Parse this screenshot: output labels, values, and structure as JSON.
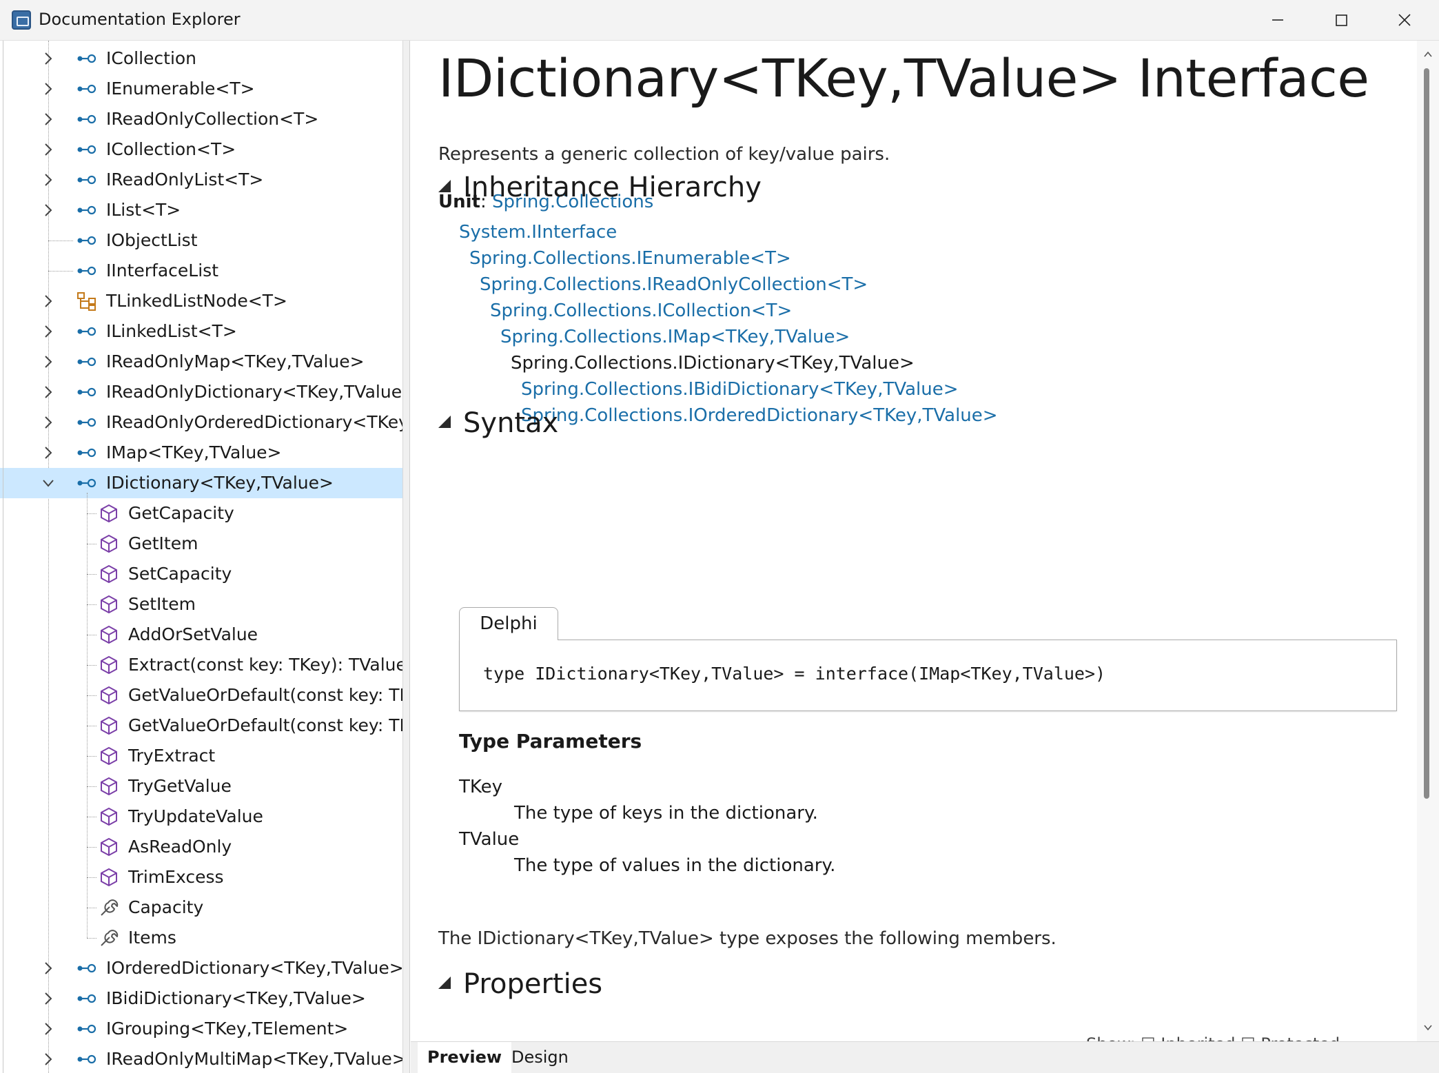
{
  "window": {
    "title": "Documentation Explorer"
  },
  "tree": {
    "items": [
      {
        "label": "ICollection",
        "icon": "interface",
        "expandable": true,
        "level": 0
      },
      {
        "label": "IEnumerable<T>",
        "icon": "interface",
        "expandable": true,
        "level": 0
      },
      {
        "label": "IReadOnlyCollection<T>",
        "icon": "interface",
        "expandable": true,
        "level": 0
      },
      {
        "label": "ICollection<T>",
        "icon": "interface",
        "expandable": true,
        "level": 0
      },
      {
        "label": "IReadOnlyList<T>",
        "icon": "interface",
        "expandable": true,
        "level": 0
      },
      {
        "label": "IList<T>",
        "icon": "interface",
        "expandable": true,
        "level": 0
      },
      {
        "label": "IObjectList",
        "icon": "interface",
        "expandable": false,
        "level": 0
      },
      {
        "label": "IInterfaceList",
        "icon": "interface",
        "expandable": false,
        "level": 0
      },
      {
        "label": "TLinkedListNode<T>",
        "icon": "class",
        "expandable": true,
        "level": 0
      },
      {
        "label": "ILinkedList<T>",
        "icon": "interface",
        "expandable": true,
        "level": 0
      },
      {
        "label": "IReadOnlyMap<TKey,TValue>",
        "icon": "interface",
        "expandable": true,
        "level": 0
      },
      {
        "label": "IReadOnlyDictionary<TKey,TValue>",
        "icon": "interface",
        "expandable": true,
        "level": 0
      },
      {
        "label": "IReadOnlyOrderedDictionary<TKey,TValue>",
        "icon": "interface",
        "expandable": true,
        "level": 0
      },
      {
        "label": "IMap<TKey,TValue>",
        "icon": "interface",
        "expandable": true,
        "level": 0
      },
      {
        "label": "IDictionary<TKey,TValue>",
        "icon": "interface",
        "expandable": true,
        "expanded": true,
        "selected": true,
        "level": 0
      },
      {
        "label": "GetCapacity",
        "icon": "method",
        "level": 1
      },
      {
        "label": "GetItem",
        "icon": "method",
        "level": 1
      },
      {
        "label": "SetCapacity",
        "icon": "method",
        "level": 1
      },
      {
        "label": "SetItem",
        "icon": "method",
        "level": 1
      },
      {
        "label": "AddOrSetValue",
        "icon": "method",
        "level": 1
      },
      {
        "label": "Extract(const key: TKey): TValue",
        "icon": "method",
        "level": 1
      },
      {
        "label": "GetValueOrDefault(const key: TKey",
        "icon": "method",
        "level": 1
      },
      {
        "label": "GetValueOrDefault(const key: TKey",
        "icon": "method",
        "level": 1
      },
      {
        "label": "TryExtract",
        "icon": "method",
        "level": 1
      },
      {
        "label": "TryGetValue",
        "icon": "method",
        "level": 1
      },
      {
        "label": "TryUpdateValue",
        "icon": "method",
        "level": 1
      },
      {
        "label": "AsReadOnly",
        "icon": "method",
        "level": 1
      },
      {
        "label": "TrimExcess",
        "icon": "method",
        "level": 1
      },
      {
        "label": "Capacity",
        "icon": "property",
        "level": 1
      },
      {
        "label": "Items",
        "icon": "property",
        "level": 1
      },
      {
        "label": "IOrderedDictionary<TKey,TValue>",
        "icon": "interface",
        "expandable": true,
        "level": 0
      },
      {
        "label": "IBidiDictionary<TKey,TValue>",
        "icon": "interface",
        "expandable": true,
        "level": 0
      },
      {
        "label": "IGrouping<TKey,TElement>",
        "icon": "interface",
        "expandable": true,
        "level": 0
      },
      {
        "label": "IReadOnlyMultiMap<TKey,TValue>",
        "icon": "interface",
        "expandable": true,
        "level": 0
      }
    ]
  },
  "doc": {
    "title": "IDictionary<TKey,TValue> Interface",
    "summary": "Represents a generic collection of key/value pairs.",
    "unit_label": "Unit",
    "unit_sep": ": ",
    "unit_value": "Spring.Collections",
    "inheritance_heading": "Inheritance Hierarchy",
    "hierarchy": [
      {
        "text": "System.IInterface",
        "link": true
      },
      {
        "text": "Spring.Collections.IEnumerable<T>",
        "link": true
      },
      {
        "text": "Spring.Collections.IReadOnlyCollection<T>",
        "link": true
      },
      {
        "text": "Spring.Collections.ICollection<T>",
        "link": true
      },
      {
        "text": "Spring.Collections.IMap<TKey,TValue>",
        "link": true
      },
      {
        "text": "Spring.Collections.IDictionary<TKey,TValue>",
        "link": false
      },
      {
        "text": "Spring.Collections.IBidiDictionary<TKey,TValue>",
        "link": true
      },
      {
        "text": "Spring.Collections.IOrderedDictionary<TKey,TValue>",
        "link": true
      }
    ],
    "syntax_heading": "Syntax",
    "code_tab": "Delphi",
    "code": "type IDictionary<TKey,TValue> = interface(IMap<TKey,TValue>)",
    "type_params_heading": "Type Parameters",
    "type_params": [
      {
        "name": "TKey",
        "desc": "The type of keys in the dictionary."
      },
      {
        "name": "TValue",
        "desc": "The type of values in the dictionary."
      }
    ],
    "members_text": "The IDictionary<TKey,TValue> type exposes the following members.",
    "properties_heading": "Properties",
    "show_strip": "Show:  ☐ Inherited   ☐ Protected"
  },
  "bottom_tabs": [
    {
      "label": "Preview",
      "active": true
    },
    {
      "label": "Design",
      "active": false
    }
  ],
  "colors": {
    "link": "#1a6ea8",
    "selection": "#cce8ff",
    "interface_icon": "#1a6ea8",
    "class_icon": "#c47a1a",
    "method_icon": "#7b3fa8",
    "property_icon": "#555555"
  }
}
